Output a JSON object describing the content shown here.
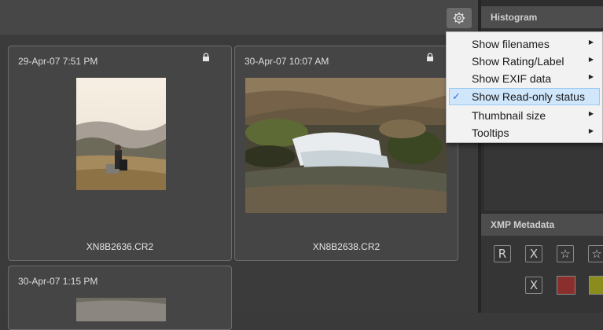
{
  "toolbar": {
    "settings_icon": "gear-icon"
  },
  "thumbnails": [
    {
      "date": "29-Apr-07 7:51 PM",
      "filename": "XN8B2636.CR2",
      "locked": true
    },
    {
      "date": "30-Apr-07 10:07 AM",
      "filename": "XN8B2638.CR2",
      "locked": true
    },
    {
      "date": "30-Apr-07 1:15 PM",
      "filename": "",
      "locked": false
    }
  ],
  "menu": {
    "items": [
      {
        "label": "Show filenames",
        "submenu": true,
        "checked": false
      },
      {
        "label": "Show Rating/Label",
        "submenu": true,
        "checked": false
      },
      {
        "label": "Show EXIF data",
        "submenu": true,
        "checked": false
      },
      {
        "label": "Show Read-only status",
        "submenu": false,
        "checked": true
      },
      {
        "label": "Thumbnail size",
        "submenu": true,
        "checked": false
      },
      {
        "label": "Tooltips",
        "submenu": true,
        "checked": false
      }
    ]
  },
  "panels": {
    "histogram_title": "Histogram",
    "xmp_title": "XMP Metadata",
    "xmp_buttons": [
      "R",
      "X",
      "☆",
      "☆"
    ],
    "xmp_reject": "X",
    "label_colors": [
      "#8b2e2e",
      "#8a8d1e"
    ]
  }
}
